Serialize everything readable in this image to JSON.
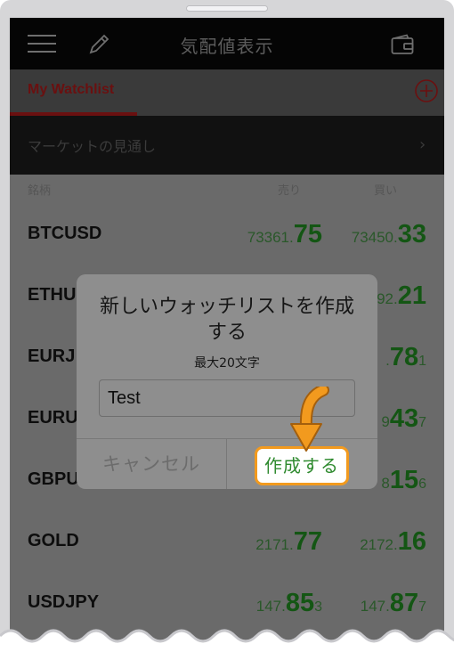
{
  "header": {
    "title": "気配値表示",
    "menu_icon": "hamburger-menu-icon",
    "edit_icon": "pencil-icon",
    "wallet_icon": "wallet-icon"
  },
  "tabs": {
    "active_label": "My Watchlist",
    "add_icon": "plus-circle-icon"
  },
  "market_outlook": {
    "label": "マーケットの見通し",
    "chevron": "›"
  },
  "columns": {
    "symbol": "銘柄",
    "sell": "売り",
    "buy": "買い"
  },
  "rows": [
    {
      "symbol": "BTCUSD",
      "sell_pre": "73361.",
      "sell_big": "75",
      "sell_sub": "",
      "buy_pre": "73450.",
      "buy_big": "33",
      "buy_sub": ""
    },
    {
      "symbol": "ETHU",
      "sell_pre": "",
      "sell_big": "",
      "sell_sub": "",
      "buy_pre": "92.",
      "buy_big": "21",
      "buy_sub": ""
    },
    {
      "symbol": "EURJ",
      "sell_pre": "",
      "sell_big": "",
      "sell_sub": "",
      "buy_pre": ".",
      "buy_big": "78",
      "buy_sub": "1"
    },
    {
      "symbol": "EURU",
      "sell_pre": "",
      "sell_big": "",
      "sell_sub": "",
      "buy_pre": "9",
      "buy_big": "43",
      "buy_sub": "7"
    },
    {
      "symbol": "GBPU",
      "sell_pre": "",
      "sell_big": "",
      "sell_sub": "",
      "buy_pre": "8",
      "buy_big": "15",
      "buy_sub": "6"
    },
    {
      "symbol": "GOLD",
      "sell_pre": "2171.",
      "sell_big": "77",
      "sell_sub": "",
      "buy_pre": "2172.",
      "buy_big": "16",
      "buy_sub": ""
    },
    {
      "symbol": "USDJPY",
      "sell_pre": "147.",
      "sell_big": "85",
      "sell_sub": "3",
      "buy_pre": "147.",
      "buy_big": "87",
      "buy_sub": "7"
    }
  ],
  "dialog": {
    "title": "新しいウォッチリストを作成する",
    "subtitle": "最大20文字",
    "input_value": "Test",
    "cancel_label": "キャンセル",
    "create_label": "作成する"
  },
  "colors": {
    "accent_red": "#6a1010",
    "price_green": "#145614",
    "highlight_orange": "#f29a1e"
  }
}
